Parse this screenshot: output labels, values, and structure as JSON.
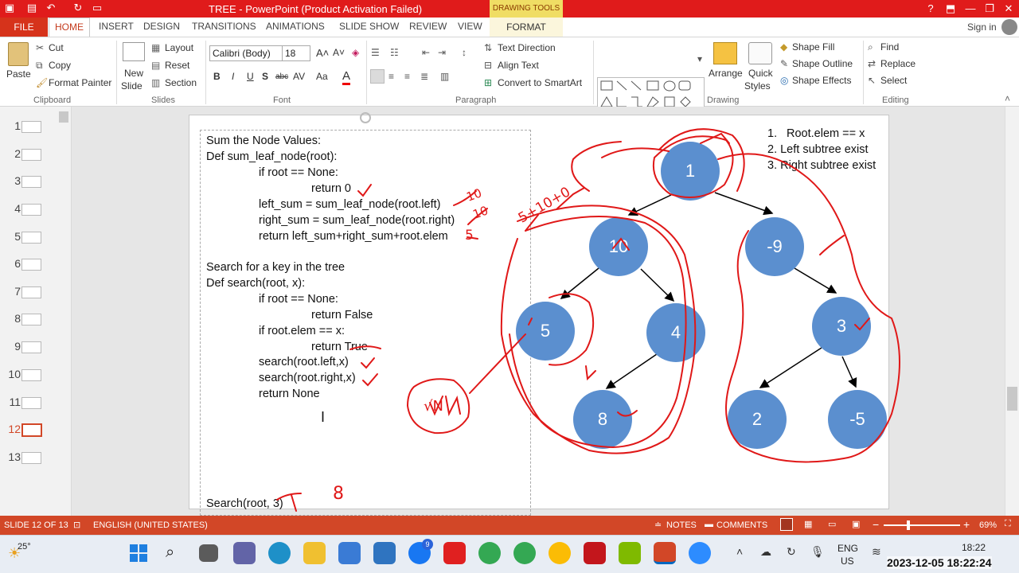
{
  "window": {
    "title": "TREE -  PowerPoint (Product Activation Failed)",
    "contextual_tab_group": "DRAWING TOOLS",
    "help": "?",
    "signin": "Sign in"
  },
  "tabs": [
    "FILE",
    "HOME",
    "INSERT",
    "DESIGN",
    "TRANSITIONS",
    "ANIMATIONS",
    "SLIDE SHOW",
    "REVIEW",
    "VIEW",
    "FORMAT"
  ],
  "ribbon": {
    "clipboard": {
      "paste": "Paste",
      "cut": "Cut",
      "copy": "Copy",
      "format_painter": "Format Painter",
      "label": "Clipboard"
    },
    "slides": {
      "new_slide_1": "New",
      "new_slide_2": "Slide",
      "layout": "Layout",
      "reset": "Reset",
      "section": "Section",
      "label": "Slides"
    },
    "font": {
      "font_name": "Calibri (Body)",
      "font_size": "18",
      "label": "Font"
    },
    "paragraph": {
      "text_direction": "Text Direction",
      "align_text": "Align Text",
      "convert_smartart": "Convert to SmartArt",
      "label": "Paragraph"
    },
    "drawing": {
      "arrange": "Arrange",
      "quick_styles_1": "Quick",
      "quick_styles_2": "Styles",
      "shape_fill": "Shape Fill",
      "shape_outline": "Shape Outline",
      "shape_effects": "Shape Effects",
      "label": "Drawing"
    },
    "editing": {
      "find": "Find",
      "replace": "Replace",
      "select": "Select",
      "label": "Editing"
    }
  },
  "thumbnails": [
    "1",
    "2",
    "3",
    "4",
    "5",
    "6",
    "7",
    "8",
    "9",
    "10",
    "11",
    "12",
    "13"
  ],
  "selected_slide": "12",
  "slide": {
    "code_lines": [
      "Sum the Node Values:",
      "Def sum_leaf_node(root):",
      "if root == None:",
      "return 0",
      "left_sum = sum_leaf_node(root.left)",
      "right_sum = sum_leaf_node(root.right)",
      "return left_sum+right_sum+root.elem",
      "Search for a key in the tree",
      "Def search(root, x):",
      "if root == None:",
      "return False",
      "if root.elem == x:",
      "return True",
      "search(root.left,x)",
      "search(root.right,x)",
      "return None",
      "Search(root, 3)"
    ],
    "conditions": [
      "1.",
      "Root.elem == x",
      "2. Left subtree exist",
      "3. Right subtree exist"
    ],
    "tree_nodes": [
      "1",
      "10",
      "-9",
      "5",
      "4",
      "3",
      "8",
      "2",
      "-5"
    ],
    "annotations": {
      "sum_note": "5+10+0",
      "five": "5",
      "ten": "10",
      "eight": "8",
      "check_n": "√N"
    }
  },
  "status": {
    "slide_info": "SLIDE 12 OF 13",
    "language": "ENGLISH (UNITED STATES)",
    "notes": "NOTES",
    "comments": "COMMENTS",
    "zoom": "69%"
  },
  "taskbar": {
    "weather": "25°",
    "lang_1": "ENG",
    "lang_2": "US",
    "time": "18:22",
    "timestamp": "2023-12-05 18:22:24",
    "badge": "9"
  },
  "colors": {
    "accent": "#d24727",
    "titlebar": "#e01b1b",
    "node": "#5b8fcf",
    "ink": "#e01818"
  }
}
